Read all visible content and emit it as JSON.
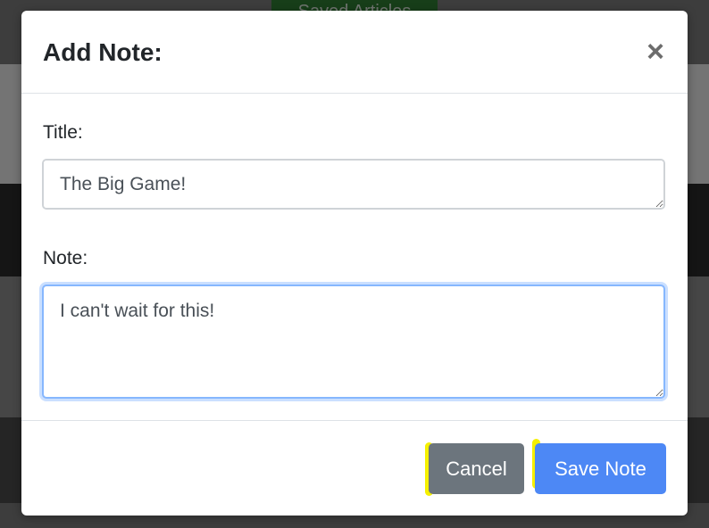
{
  "background": {
    "nav_tab_label": "Saved Articles"
  },
  "modal": {
    "title": "Add Note:",
    "close_label": "×",
    "title_field": {
      "label": "Title:",
      "value": "The Big Game!"
    },
    "note_field": {
      "label": "Note:",
      "value": "I can't wait for this!"
    },
    "buttons": {
      "cancel_label": "Cancel",
      "save_label": "Save Note"
    }
  },
  "colors": {
    "save_button": "#4d88f5",
    "cancel_button": "#6c757d",
    "highlight": "#f5f000",
    "focus_border": "#86b7fe"
  }
}
